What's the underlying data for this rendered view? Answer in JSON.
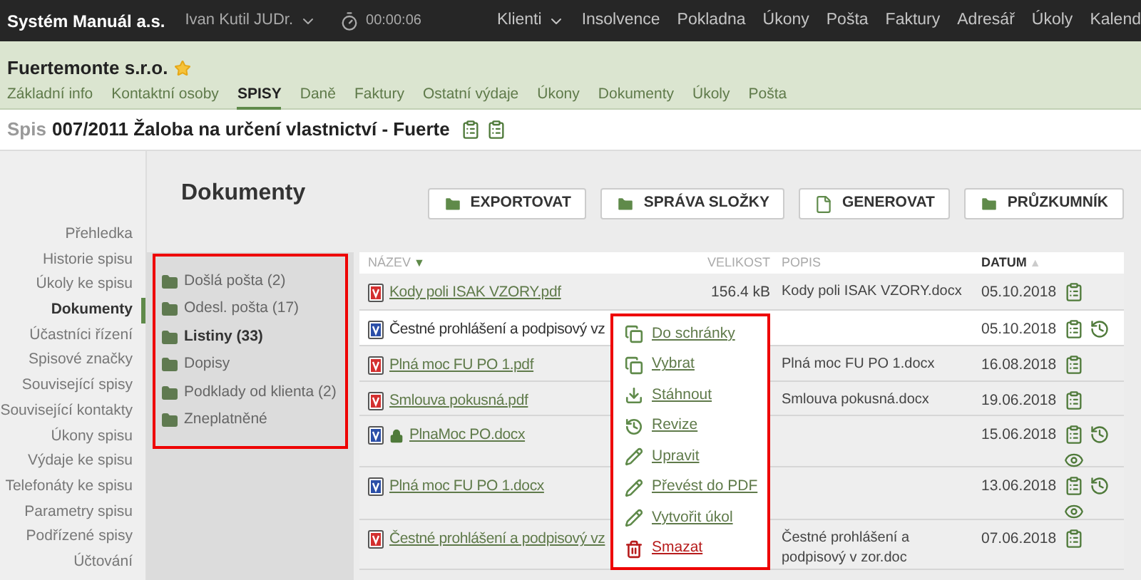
{
  "top_bar": {
    "company": "Systém Manuál a.s.",
    "user": "Ivan Kutil JUDr.",
    "timer": "00:00:06",
    "nav": [
      {
        "label": "Klienti",
        "dropdown": true
      },
      {
        "label": "Insolvence",
        "dropdown": false
      },
      {
        "label": "Pokladna",
        "dropdown": false
      },
      {
        "label": "Úkony",
        "dropdown": false
      },
      {
        "label": "Pošta",
        "dropdown": false
      },
      {
        "label": "Faktury",
        "dropdown": false
      },
      {
        "label": "Adresář",
        "dropdown": false
      },
      {
        "label": "Úkoly",
        "dropdown": false
      },
      {
        "label": "Kalend",
        "dropdown": false
      }
    ]
  },
  "client": {
    "name": "Fuertemonte s.r.o.",
    "starred": true,
    "tabs": [
      {
        "label": "Základní info",
        "selected": false
      },
      {
        "label": "Kontaktní osoby",
        "selected": false
      },
      {
        "label": "SPISY",
        "selected": true
      },
      {
        "label": "Daně",
        "selected": false
      },
      {
        "label": "Faktury",
        "selected": false
      },
      {
        "label": "Ostatní výdaje",
        "selected": false
      },
      {
        "label": "Úkony",
        "selected": false
      },
      {
        "label": "Dokumenty",
        "selected": false
      },
      {
        "label": "Úkoly",
        "selected": false
      },
      {
        "label": "Pošta",
        "selected": false
      }
    ]
  },
  "spis": {
    "prefix": "Spis",
    "title": "007/2011 Žaloba na určení vlastnictví - Fuerte"
  },
  "sidebar": {
    "items": [
      {
        "label": "Přehledka",
        "selected": false
      },
      {
        "label": "Historie spisu",
        "selected": false
      },
      {
        "label": "Úkoly ke spisu",
        "selected": false
      },
      {
        "label": "Dokumenty",
        "selected": true
      },
      {
        "label": "Účastníci řízení",
        "selected": false
      },
      {
        "label": "Spisové značky",
        "selected": false
      },
      {
        "label": "Související spisy",
        "selected": false
      },
      {
        "label": "Související kontakty",
        "selected": false
      },
      {
        "label": "Úkony spisu",
        "selected": false
      },
      {
        "label": "Výdaje ke spisu",
        "selected": false
      },
      {
        "label": "Telefonáty ke spisu",
        "selected": false
      },
      {
        "label": "Parametry spisu",
        "selected": false
      },
      {
        "label": "Podřízené spisy",
        "selected": false
      },
      {
        "label": "Účtování",
        "selected": false
      }
    ]
  },
  "page_title": "Dokumenty",
  "buttons": [
    {
      "label": "EXPORTOVAT",
      "kind": "folder"
    },
    {
      "label": "SPRÁVA SLOŽKY",
      "kind": "folder"
    },
    {
      "label": "GENEROVAT",
      "kind": "file"
    },
    {
      "label": "PRŮZKUMNÍK",
      "kind": "folder"
    }
  ],
  "folders": [
    {
      "label": "Došlá pošta (2)",
      "selected": false
    },
    {
      "label": "Odesl. pošta (17)",
      "selected": false
    },
    {
      "label": "Listiny (33)",
      "selected": true
    },
    {
      "label": "Dopisy",
      "selected": false
    },
    {
      "label": "Podklady od klienta (2)",
      "selected": false
    },
    {
      "label": "Zneplatněné",
      "selected": false
    }
  ],
  "table": {
    "columns": [
      {
        "label": "NÁZEV",
        "sort_mark": "▼",
        "active": false
      },
      {
        "label": "VELIKOST",
        "active": false
      },
      {
        "label": "POPIS",
        "active": false
      },
      {
        "label": "DATUM",
        "sort_mark": "▲",
        "active": true
      }
    ],
    "rows": [
      {
        "kind": "pdf",
        "name": "Kody poli ISAK VZORY.pdf",
        "linked": true,
        "locked": false,
        "highlighted": false,
        "size": "156.4 kB",
        "description": "Kody poli ISAK VZORY.docx",
        "date": "05.10.2018",
        "actions": [
          {
            "kind": "clipboard"
          }
        ]
      },
      {
        "kind": "docx",
        "name": "Čestné prohlášení a podpisový vz",
        "linked": false,
        "locked": false,
        "highlighted": true,
        "date": "05.10.2018",
        "actions": [
          {
            "kind": "clipboard"
          },
          {
            "kind": "history"
          }
        ]
      },
      {
        "kind": "pdf",
        "name": "Plná moc FU PO 1.pdf",
        "linked": true,
        "locked": false,
        "highlighted": false,
        "description": "Plná moc FU PO 1.docx",
        "date": "16.08.2018",
        "actions": [
          {
            "kind": "clipboard"
          }
        ]
      },
      {
        "kind": "pdf",
        "name": "Smlouva pokusná.pdf",
        "linked": true,
        "locked": false,
        "highlighted": false,
        "description": "Smlouva pokusná.docx",
        "date": "19.06.2018",
        "actions": [
          {
            "kind": "clipboard"
          }
        ]
      },
      {
        "kind": "docx",
        "name": "PlnaMoc PO.docx",
        "linked": true,
        "locked": true,
        "highlighted": false,
        "date": "15.06.2018",
        "actions": [
          {
            "kind": "clipboard"
          },
          {
            "kind": "history"
          },
          {
            "kind": "eye"
          }
        ]
      },
      {
        "kind": "docx",
        "name": "Plná moc FU PO 1.docx",
        "linked": true,
        "locked": false,
        "highlighted": false,
        "date": "13.06.2018",
        "actions": [
          {
            "kind": "clipboard"
          },
          {
            "kind": "history"
          },
          {
            "kind": "eye"
          }
        ]
      },
      {
        "kind": "pdf",
        "name": "Čestné prohlášení a podpisový vz",
        "linked": true,
        "locked": false,
        "highlighted": false,
        "description": "Čestné prohlášení a podpisový v zor.doc",
        "date": "07.06.2018",
        "actions": [
          {
            "kind": "clipboard"
          }
        ]
      }
    ]
  },
  "context_menu": {
    "items": [
      {
        "label": "Do schránky",
        "kind": "copy",
        "danger": false
      },
      {
        "label": "Vybrat",
        "kind": "copy",
        "danger": false
      },
      {
        "label": "Stáhnout",
        "kind": "download",
        "danger": false
      },
      {
        "label": "Revize",
        "kind": "history",
        "danger": false
      },
      {
        "label": "Upravit",
        "kind": "pencil",
        "danger": false
      },
      {
        "label": "Převést do PDF",
        "kind": "pencil",
        "danger": false
      },
      {
        "label": "Vytvořit úkol",
        "kind": "pencil",
        "danger": false
      },
      {
        "label": "Smazat",
        "kind": "trash",
        "danger": true
      }
    ]
  }
}
